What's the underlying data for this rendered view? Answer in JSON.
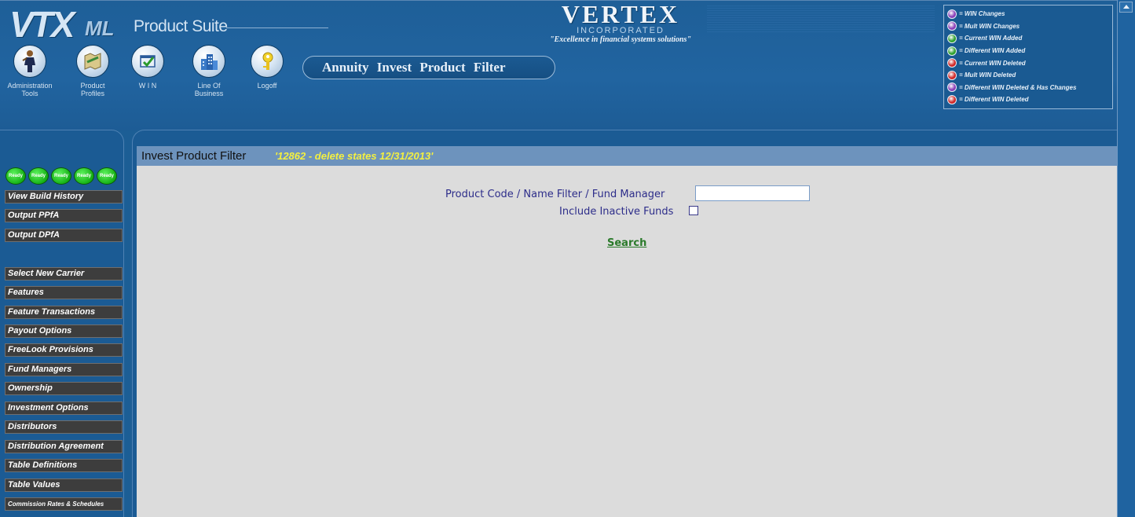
{
  "header": {
    "logo_vtx": "VTX",
    "logo_ml": "ML",
    "logo_suite": "Product Suite",
    "company_name": "VERTEX",
    "company_inc": "INCORPORATED",
    "company_tagline": "\"Excellence in financial systems solutions\"",
    "page_title": "Annuity Invest Product Filter",
    "nav": [
      {
        "label": "Administration\nTools",
        "icon": "person-icon"
      },
      {
        "label": "Product\nProfiles",
        "icon": "map-icon"
      },
      {
        "label": "W I N",
        "icon": "checkmark-window-icon"
      },
      {
        "label": "Line Of\nBusiness",
        "icon": "buildings-icon"
      },
      {
        "label": "Logoff",
        "icon": "key-icon"
      }
    ]
  },
  "legend": [
    {
      "label": "= WIN Changes",
      "color": "#8a3fb8"
    },
    {
      "label": "= Mult WIN Changes",
      "color": "#8a3fb8"
    },
    {
      "label": "= Current WIN Added",
      "color": "#2ea02e"
    },
    {
      "label": "= Different WIN Added",
      "color": "#2ea02e"
    },
    {
      "label": "= Current WIN Deleted",
      "color": "#d02828"
    },
    {
      "label": "= Mult WIN Deleted",
      "color": "#d02828"
    },
    {
      "label": "= Different WIN Deleted & Has Changes",
      "color": "#8a3fb8"
    },
    {
      "label": "= Different WIN Deleted",
      "color": "#d02828"
    }
  ],
  "sidebar": {
    "ready_label": "Ready",
    "items": [
      "View Build History",
      "Output PPfA",
      "Output DPfA",
      "Select New Carrier",
      "Features",
      "Feature Transactions",
      "Payout Options",
      "FreeLook Provisions",
      "Fund Managers",
      "Ownership",
      "Investment Options",
      "Distributors",
      "Distribution Agreement",
      "Table Definitions",
      "Table Values",
      "Commission Rates & Schedules"
    ]
  },
  "content": {
    "title": "Invest Product Filter",
    "subtitle": "'12862 - delete states 12/31/2013'",
    "filter_label": "Product Code / Name Filter / Fund Manager",
    "filter_value": "",
    "inactive_label": "Include Inactive Funds",
    "search_label": "Search"
  },
  "colors": {
    "header_blue": "#1e5f98",
    "content_bg": "#dcdcdc",
    "title_bar": "#6d93bd",
    "subtitle_yellow": "#f4f040",
    "label_text": "#2d2d8a",
    "search_link": "#2a7a2a",
    "sidebar_button": "#3d3d3d",
    "ready_green": "#15b015"
  }
}
